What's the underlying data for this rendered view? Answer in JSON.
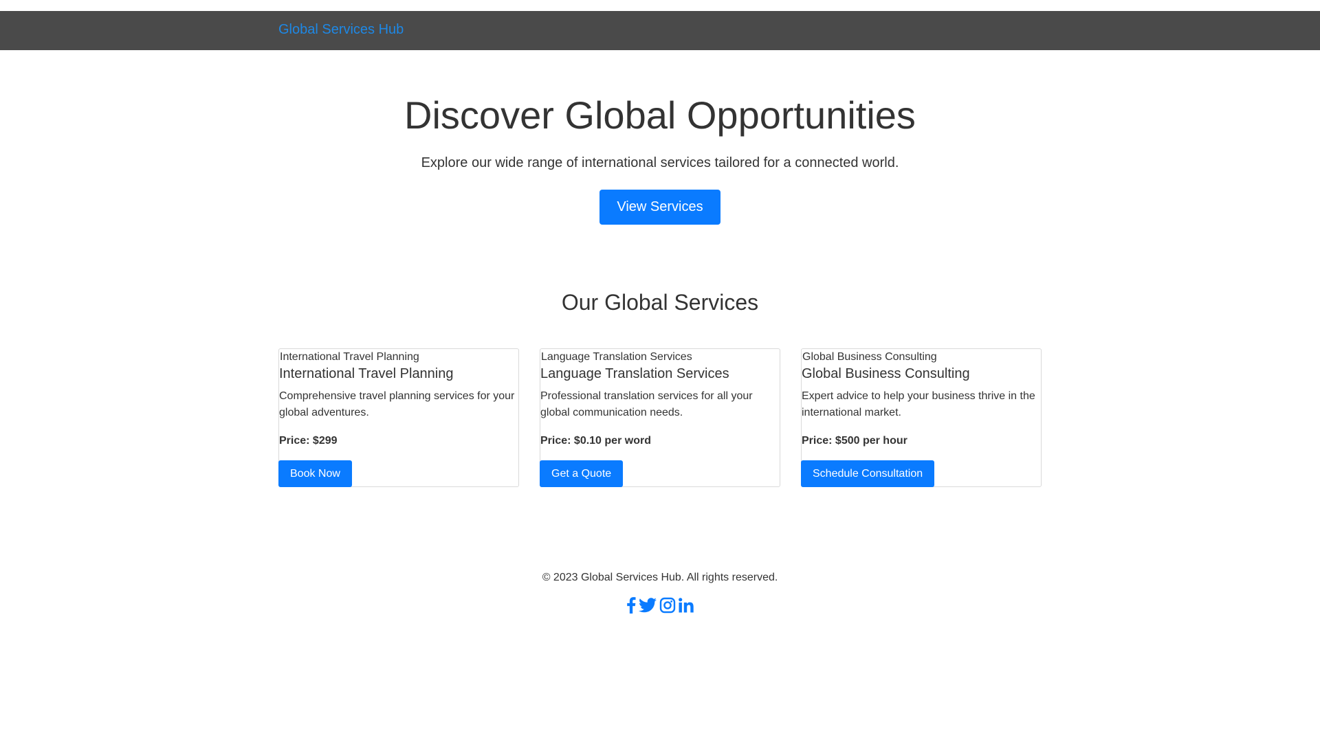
{
  "navbar": {
    "brand": "Global Services Hub"
  },
  "hero": {
    "title": "Discover Global Opportunities",
    "subtitle": "Explore our wide range of international services tailored for a connected world.",
    "button_label": "View Services"
  },
  "services": {
    "title": "Our Global Services",
    "cards": [
      {
        "image_alt": "International Travel Planning",
        "title": "International Travel Planning",
        "description": "Comprehensive travel planning services for your global adventures.",
        "price": "Price: $299",
        "button_label": "Book Now"
      },
      {
        "image_alt": "Language Translation Services",
        "title": "Language Translation Services",
        "description": "Professional translation services for all your global communication needs.",
        "price": "Price: $0.10 per word",
        "button_label": "Get a Quote"
      },
      {
        "image_alt": "Global Business Consulting",
        "title": "Global Business Consulting",
        "description": "Expert advice to help your business thrive in the international market.",
        "price": "Price: $500 per hour",
        "button_label": "Schedule Consultation"
      }
    ]
  },
  "footer": {
    "copyright": "© 2023 Global Services Hub. All rights reserved.",
    "social_icons": [
      "facebook-icon",
      "twitter-icon",
      "instagram-icon",
      "linkedin-icon"
    ]
  },
  "colors": {
    "navbar_bg": "#4a4a4a",
    "accent": "#0a7bff",
    "brand_link": "#1e88e5",
    "text": "#333333"
  }
}
